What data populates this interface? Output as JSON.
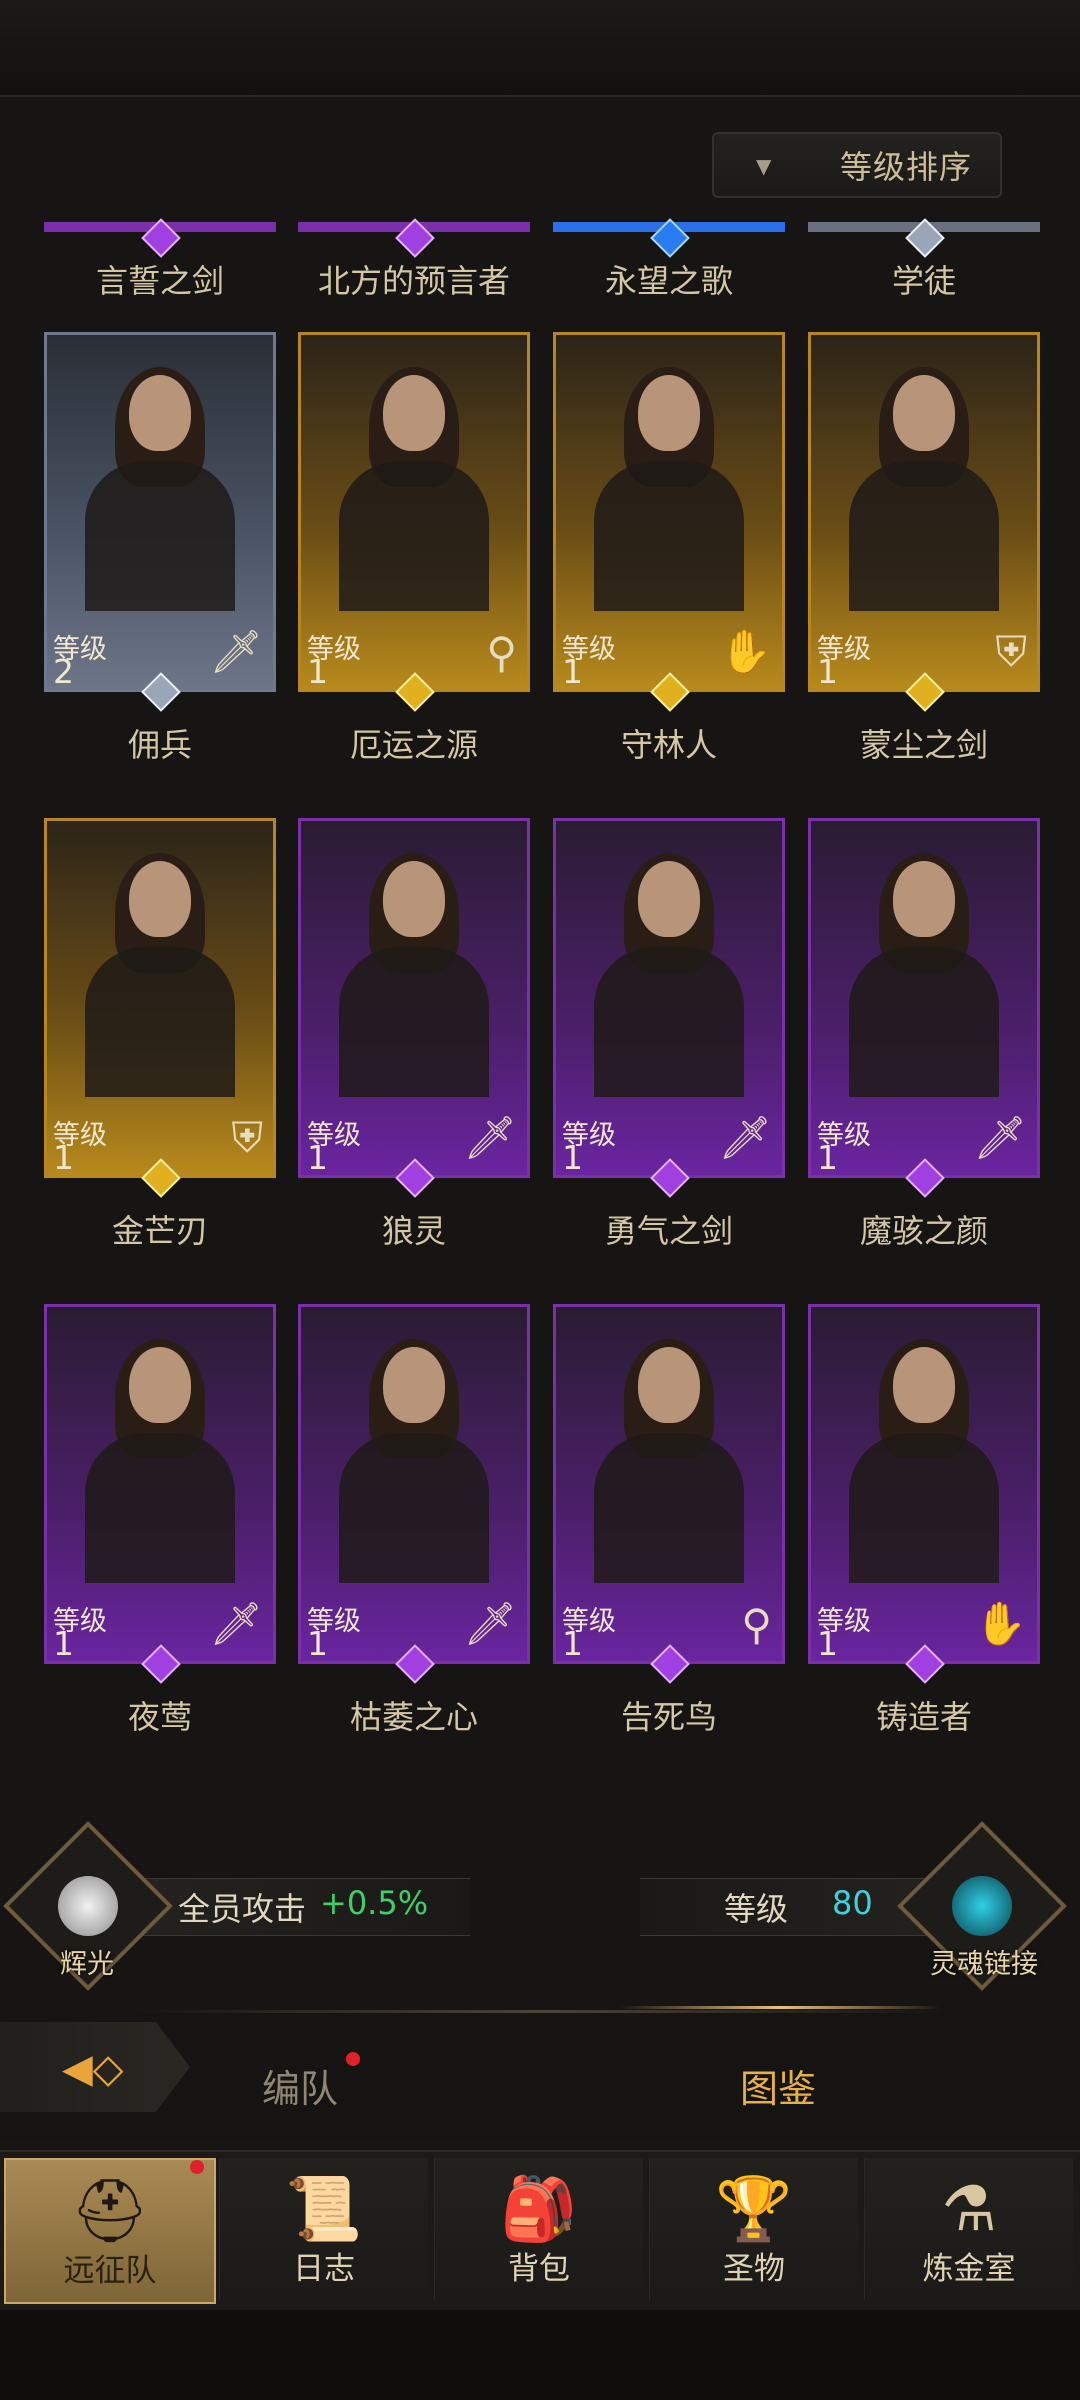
{
  "sort": {
    "label": "等级排序",
    "arrow_icon": "triangle-down-icon"
  },
  "top_row": [
    {
      "name": "言誓之剑",
      "rarity": "purple"
    },
    {
      "name": "北方的预言者",
      "rarity": "purple"
    },
    {
      "name": "永望之歌",
      "rarity": "blue"
    },
    {
      "name": "学徒",
      "rarity": "gray"
    }
  ],
  "level_label": "等级",
  "heroes": [
    {
      "name": "佣兵",
      "level": "2",
      "rarity": "gray",
      "class_icon": "sword-icon"
    },
    {
      "name": "厄运之源",
      "level": "1",
      "rarity": "gold",
      "class_icon": "staff-icon"
    },
    {
      "name": "守林人",
      "level": "1",
      "rarity": "gold",
      "class_icon": "hand-icon"
    },
    {
      "name": "蒙尘之剑",
      "level": "1",
      "rarity": "gold",
      "class_icon": "shield-icon"
    },
    {
      "name": "金芒刃",
      "level": "1",
      "rarity": "gold",
      "class_icon": "shield-icon"
    },
    {
      "name": "狼灵",
      "level": "1",
      "rarity": "purple",
      "class_icon": "sword-icon"
    },
    {
      "name": "勇气之剑",
      "level": "1",
      "rarity": "purple",
      "class_icon": "sword-icon"
    },
    {
      "name": "魔骇之颜",
      "level": "1",
      "rarity": "purple",
      "class_icon": "sword-icon"
    },
    {
      "name": "夜莺",
      "level": "1",
      "rarity": "purple",
      "class_icon": "sword-icon"
    },
    {
      "name": "枯萎之心",
      "level": "1",
      "rarity": "purple",
      "class_icon": "sword-icon"
    },
    {
      "name": "告死鸟",
      "level": "1",
      "rarity": "purple",
      "class_icon": "staff-icon"
    },
    {
      "name": "铸造者",
      "level": "1",
      "rarity": "purple",
      "class_icon": "hand-icon"
    }
  ],
  "status": {
    "left_emblem_label": "辉光",
    "attack_label": "全员攻击",
    "attack_value": "+0.5%",
    "level_label": "等级",
    "level_value": "80",
    "right_emblem_label": "灵魂链接"
  },
  "tabs": {
    "formation": "编队",
    "codex": "图鉴"
  },
  "nav": [
    {
      "label": "远征队",
      "icon": "helmet-icon",
      "active": true
    },
    {
      "label": "日志",
      "icon": "map-scroll-icon"
    },
    {
      "label": "背包",
      "icon": "backpack-icon"
    },
    {
      "label": "圣物",
      "icon": "chalice-icon"
    },
    {
      "label": "炼金室",
      "icon": "alchemy-icon"
    }
  ]
}
